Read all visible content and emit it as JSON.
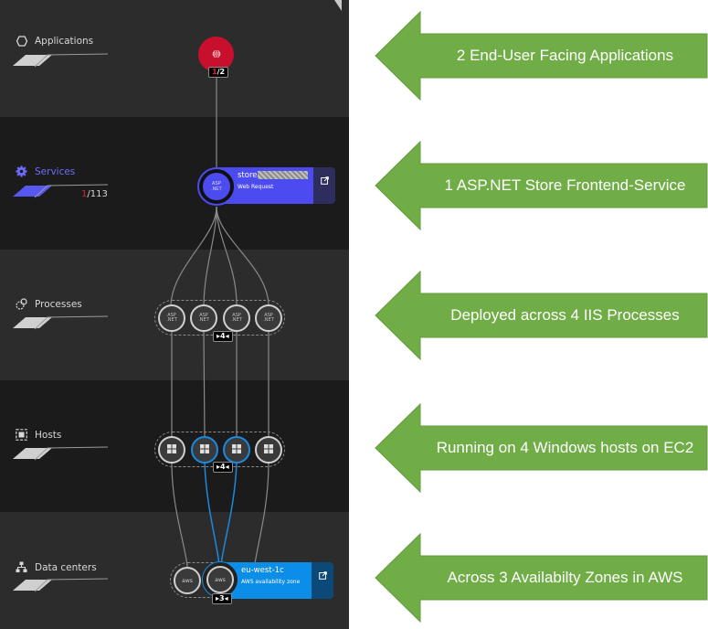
{
  "panel": {
    "layers": [
      {
        "id": "applications",
        "label": "Applications",
        "icon": "hexagon-icon",
        "active": false
      },
      {
        "id": "services",
        "label": "Services",
        "icon": "gear-icon",
        "active": true,
        "count_highlight": "1",
        "count_total": "/113"
      },
      {
        "id": "processes",
        "label": "Processes",
        "icon": "processes-icon",
        "active": false
      },
      {
        "id": "hosts",
        "label": "Hosts",
        "icon": "host-icon",
        "active": false
      },
      {
        "id": "datacenters",
        "label": "Data centers",
        "icon": "network-tree-icon",
        "active": false
      }
    ],
    "application_node": {
      "icon": "globe-icon",
      "badge_highlight": "1",
      "badge_total": "/2",
      "color": "#c8102e"
    },
    "service_card": {
      "icon_text_1": "ASP",
      "icon_text_2": ".NET",
      "name": "store",
      "name_redacted": "xxxxxxxxxx",
      "type": "Web Request",
      "color": "#4b4bf0",
      "ext_color": "#2e2e5e"
    },
    "processes": {
      "items": [
        "ASP.NET",
        "ASP.NET",
        "ASP.NET",
        "ASP.NET"
      ],
      "badge": "4"
    },
    "hosts": {
      "items": [
        "windows",
        "windows",
        "windows",
        "windows"
      ],
      "highlighted": [
        1,
        2
      ],
      "badge": "4"
    },
    "datacenters": {
      "items": [
        "aws",
        "aws"
      ],
      "badge": "3",
      "card_name": "eu-west-1c",
      "card_type": "AWS availability zone",
      "color": "#0c8ee8",
      "ext_color": "#0b4a78"
    }
  },
  "annotations": [
    {
      "text": "2 End-User  Facing Applications"
    },
    {
      "text": "1 ASP.NET Store Frontend-Service"
    },
    {
      "text": "Deployed across 4 IIS Processes"
    },
    {
      "text": "Running on 4 Windows hosts on EC2"
    },
    {
      "text": "Across 3 Availabilty Zones in AWS"
    }
  ],
  "colors": {
    "arrow_fill": "#70ad47",
    "arrow_stroke": "#5f9a3a",
    "highlight_blue": "#1a8ae0"
  }
}
